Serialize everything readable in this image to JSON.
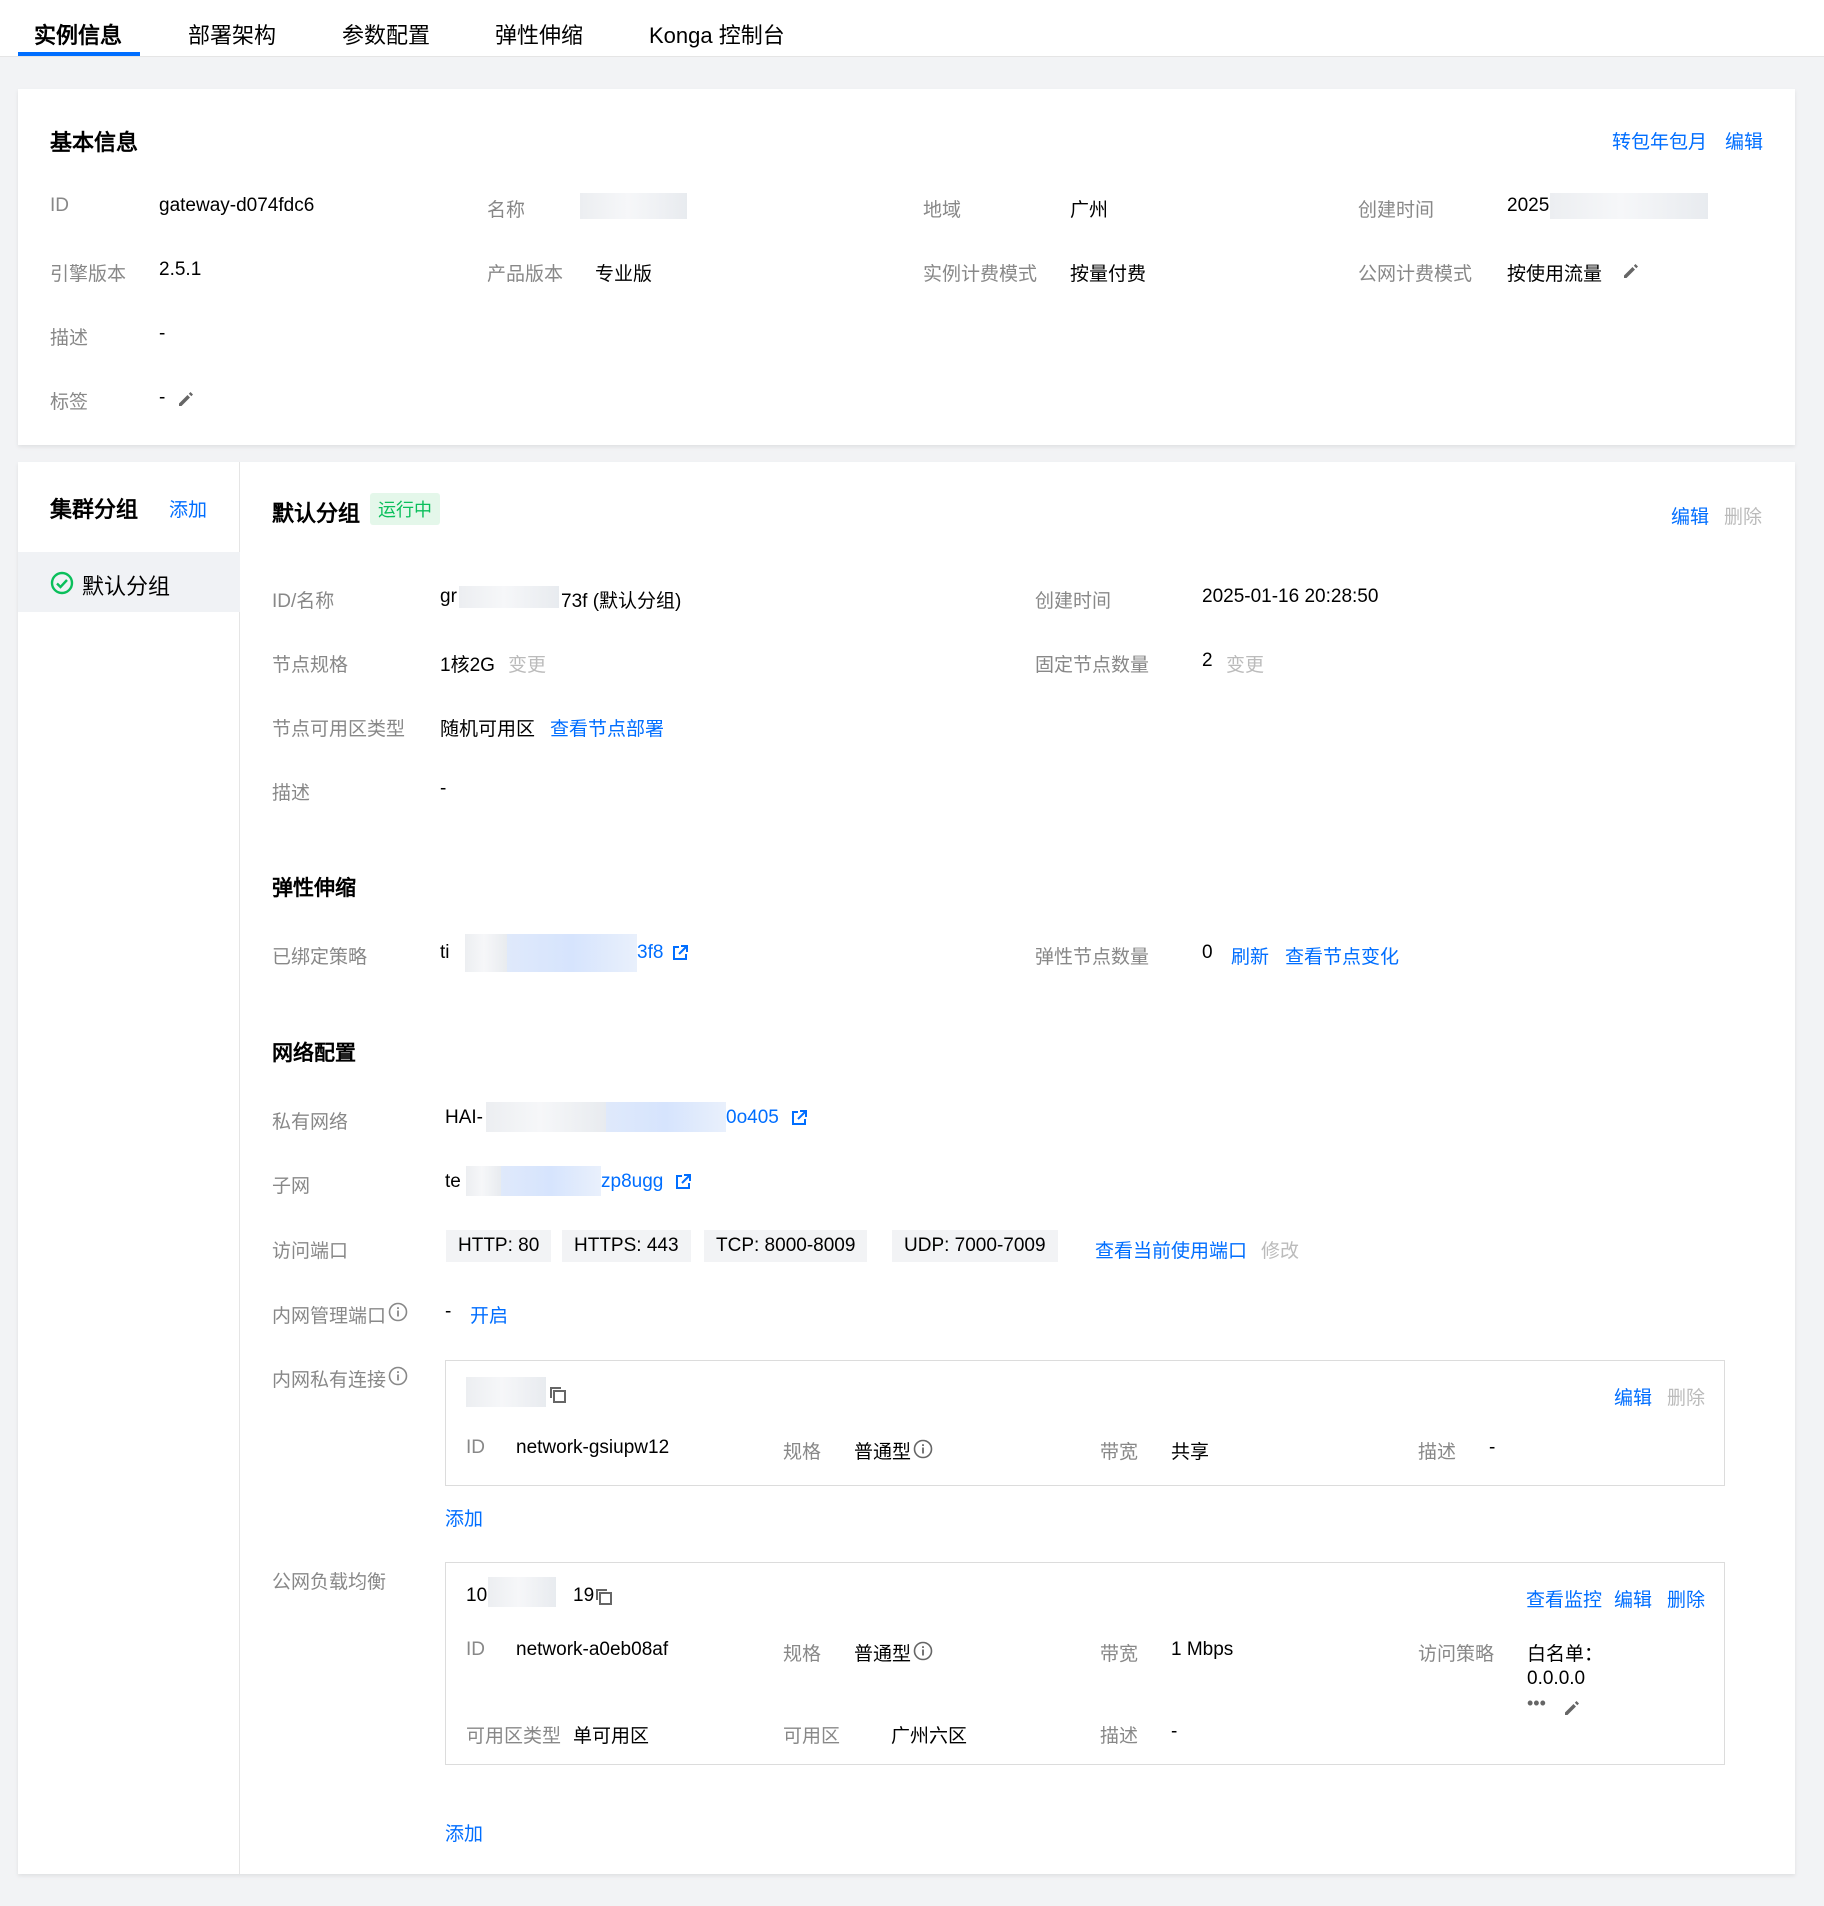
{
  "tabs": [
    "实例信息",
    "部署架构",
    "参数配置",
    "弹性伸缩",
    "Konga 控制台"
  ],
  "basic": {
    "title": "基本信息",
    "action_prepaid": "转包年包月",
    "action_edit": "编辑",
    "id_label": "ID",
    "id_value": "gateway-d074fdc6",
    "name_label": "名称",
    "region_label": "地域",
    "region_value": "广州",
    "created_label": "创建时间",
    "created_value_prefix": "2025",
    "engine_label": "引擎版本",
    "engine_value": "2.5.1",
    "product_label": "产品版本",
    "product_value": "专业版",
    "billing_label": "实例计费模式",
    "billing_value": "按量付费",
    "net_billing_label": "公网计费模式",
    "net_billing_value": "按使用流量",
    "desc_label": "描述",
    "desc_value": "-",
    "tags_label": "标签",
    "tags_value": "-"
  },
  "sidebar": {
    "title": "集群分组",
    "add": "添加",
    "items": [
      "默认分组"
    ]
  },
  "group": {
    "title": "默认分组",
    "status": "运行中",
    "edit": "编辑",
    "delete": "删除",
    "idname_label": "ID/名称",
    "idname_prefix": "gr",
    "idname_suffix": "73f (默认分组)",
    "created_label": "创建时间",
    "created_value": "2025-01-16 20:28:50",
    "spec_label": "节点规格",
    "spec_value": "1核2G",
    "spec_change": "变更",
    "fixed_nodes_label": "固定节点数量",
    "fixed_nodes_value": "2",
    "fixed_nodes_change": "变更",
    "zone_type_label": "节点可用区类型",
    "zone_type_value": "随机可用区",
    "zone_type_link": "查看节点部署",
    "desc_label": "描述",
    "desc_value": "-"
  },
  "scaling": {
    "title": "弹性伸缩",
    "policy_label": "已绑定策略",
    "policy_prefix": "ti",
    "policy_suffix": "3f8",
    "elastic_nodes_label": "弹性节点数量",
    "elastic_nodes_value": "0",
    "refresh": "刷新",
    "view_changes": "查看节点变化"
  },
  "network": {
    "title": "网络配置",
    "vpc_label": "私有网络",
    "vpc_prefix": "HAI-",
    "vpc_suffix": "0o405",
    "subnet_label": "子网",
    "subnet_prefix": "te",
    "subnet_suffix": "zp8ugg",
    "ports_label": "访问端口",
    "ports": [
      "HTTP: 80",
      "HTTPS: 443",
      "TCP: 8000-8009",
      "UDP: 7000-7009"
    ],
    "ports_view": "查看当前使用端口",
    "ports_modify": "修改",
    "mgmt_label": "内网管理端口",
    "mgmt_value": "-",
    "mgmt_enable": "开启",
    "private_label": "内网私有连接",
    "private_conn": {
      "edit": "编辑",
      "delete": "删除",
      "id_label": "ID",
      "id_value": "network-gsiupw12",
      "spec_label": "规格",
      "spec_value": "普通型",
      "bw_label": "带宽",
      "bw_value": "共享",
      "desc_label": "描述",
      "desc_value": "-"
    },
    "private_add": "添加",
    "public_label": "公网负载均衡",
    "public_lb": {
      "ip_prefix": "10",
      "ip_suffix": "19",
      "monitor": "查看监控",
      "edit": "编辑",
      "delete": "删除",
      "id_label": "ID",
      "id_value": "network-a0eb08af",
      "spec_label": "规格",
      "spec_value": "普通型",
      "bw_label": "带宽",
      "bw_value": "1 Mbps",
      "policy_label": "访问策略",
      "policy_value_1": "白名单：",
      "policy_value_2": "0.0.0.0",
      "policy_more": "•••",
      "zone_type_label": "可用区类型",
      "zone_type_value": "单可用区",
      "zone_label": "可用区",
      "zone_value": "广州六区",
      "desc_label": "描述",
      "desc_value": "-"
    },
    "public_add": "添加"
  },
  "colors": {
    "accent": "#006eff",
    "success": "#0abf5b",
    "muted": "#bbbbbb"
  }
}
